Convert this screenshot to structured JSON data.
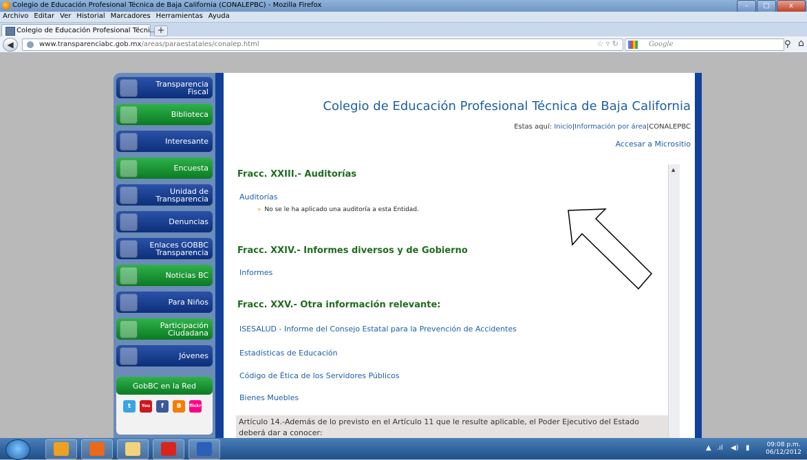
{
  "window": {
    "title": "Colegio de Educación Profesional Técnica de Baja California (CONALEPBC) - Mozilla Firefox",
    "controls": {
      "minimize": "–",
      "maximize": "□",
      "close": "x"
    }
  },
  "menubar": [
    "Archivo",
    "Editar",
    "Ver",
    "Historial",
    "Marcadores",
    "Herramientas",
    "Ayuda"
  ],
  "tabs": [
    {
      "label": "Colegio de Educación Profesional Técni..."
    }
  ],
  "newtab_label": "+",
  "navbar": {
    "url_domain": "www.transparenciabc.gob.mx",
    "url_path": "/areas/paraestatales/conalep.html",
    "search_placeholder": "Google"
  },
  "sidebar": {
    "items": [
      {
        "label": "Transparencia Fiscal",
        "color": "blue",
        "icon": "hand-icon"
      },
      {
        "label": "Biblioteca",
        "color": "green",
        "icon": "books-icon"
      },
      {
        "label": "Interesante",
        "color": "blue",
        "icon": "people-icon"
      },
      {
        "label": "Encuesta",
        "color": "green",
        "icon": "survey-icon"
      },
      {
        "label": "Unidad de Transparencia",
        "color": "blue",
        "icon": "lock-icon"
      },
      {
        "label": "Denuncias",
        "color": "blue",
        "icon": "police-car-icon"
      },
      {
        "label": "Enlaces GOBBC Transparencia",
        "color": "blue",
        "icon": "globe-icon"
      },
      {
        "label": "Noticias BC",
        "color": "green",
        "icon": "news-icon"
      },
      {
        "label": "Para Niños",
        "color": "blue",
        "icon": "kids-icon"
      },
      {
        "label": "Participación Ciudadana",
        "color": "green",
        "icon": "citizens-icon"
      },
      {
        "label": "Jóvenes",
        "color": "blue",
        "icon": "youth-icon"
      }
    ],
    "social_header": "GobBC en la Red",
    "social_icons": [
      {
        "name": "twitter-icon",
        "glyph": "t",
        "color": "#3aa3e3"
      },
      {
        "name": "youtube-icon",
        "glyph": "You",
        "color": "#cc181e"
      },
      {
        "name": "facebook-icon",
        "glyph": "f",
        "color": "#3b5998"
      },
      {
        "name": "blogger-icon",
        "glyph": "B",
        "color": "#f57d00"
      },
      {
        "name": "flickr-icon",
        "glyph": "flickr",
        "color": "#ff0084"
      }
    ]
  },
  "main": {
    "title": "Colegio de Educación Profesional Técnica de Baja California",
    "breadcrumb": {
      "prefix": "Estas aquí:",
      "inicio": "Inicio",
      "info": "Información por área",
      "current": "CONALEPBC"
    },
    "microsite_link": "Accesar a Micrositio",
    "sections": [
      {
        "heading": "Fracc. XXIII.- Auditorías",
        "link": "Auditorías",
        "note": "No se le ha aplicado una auditoría a esta Entidad."
      },
      {
        "heading": "Fracc. XXIV.- Informes diversos y de Gobierno",
        "link": "Informes"
      },
      {
        "heading": "Fracc. XXV.- Otra información relevante:",
        "links": [
          "ISESALUD - Informe del Consejo Estatal para la Prevención de Accidentes",
          "Estadísticas de Educación",
          "Código de Ética de los Servidores Públicos",
          "Bienes Muebles"
        ]
      }
    ],
    "articulo": "Artículo 14.-Además de lo previsto en el Artículo 11 que le resulte aplicable, el Poder Ejecutivo del Estado deberá dar a conocer:"
  },
  "taskbar": {
    "apps": [
      {
        "name": "outlook-icon",
        "color": "#f0a020"
      },
      {
        "name": "firefox-icon",
        "color": "#e86a1a"
      },
      {
        "name": "explorer-icon",
        "color": "#f2d27a"
      },
      {
        "name": "acrobat-icon",
        "color": "#d9261c"
      },
      {
        "name": "word-icon",
        "color": "#2b5fb8"
      }
    ],
    "time": "09:08 p.m.",
    "date": "06/12/2012"
  }
}
